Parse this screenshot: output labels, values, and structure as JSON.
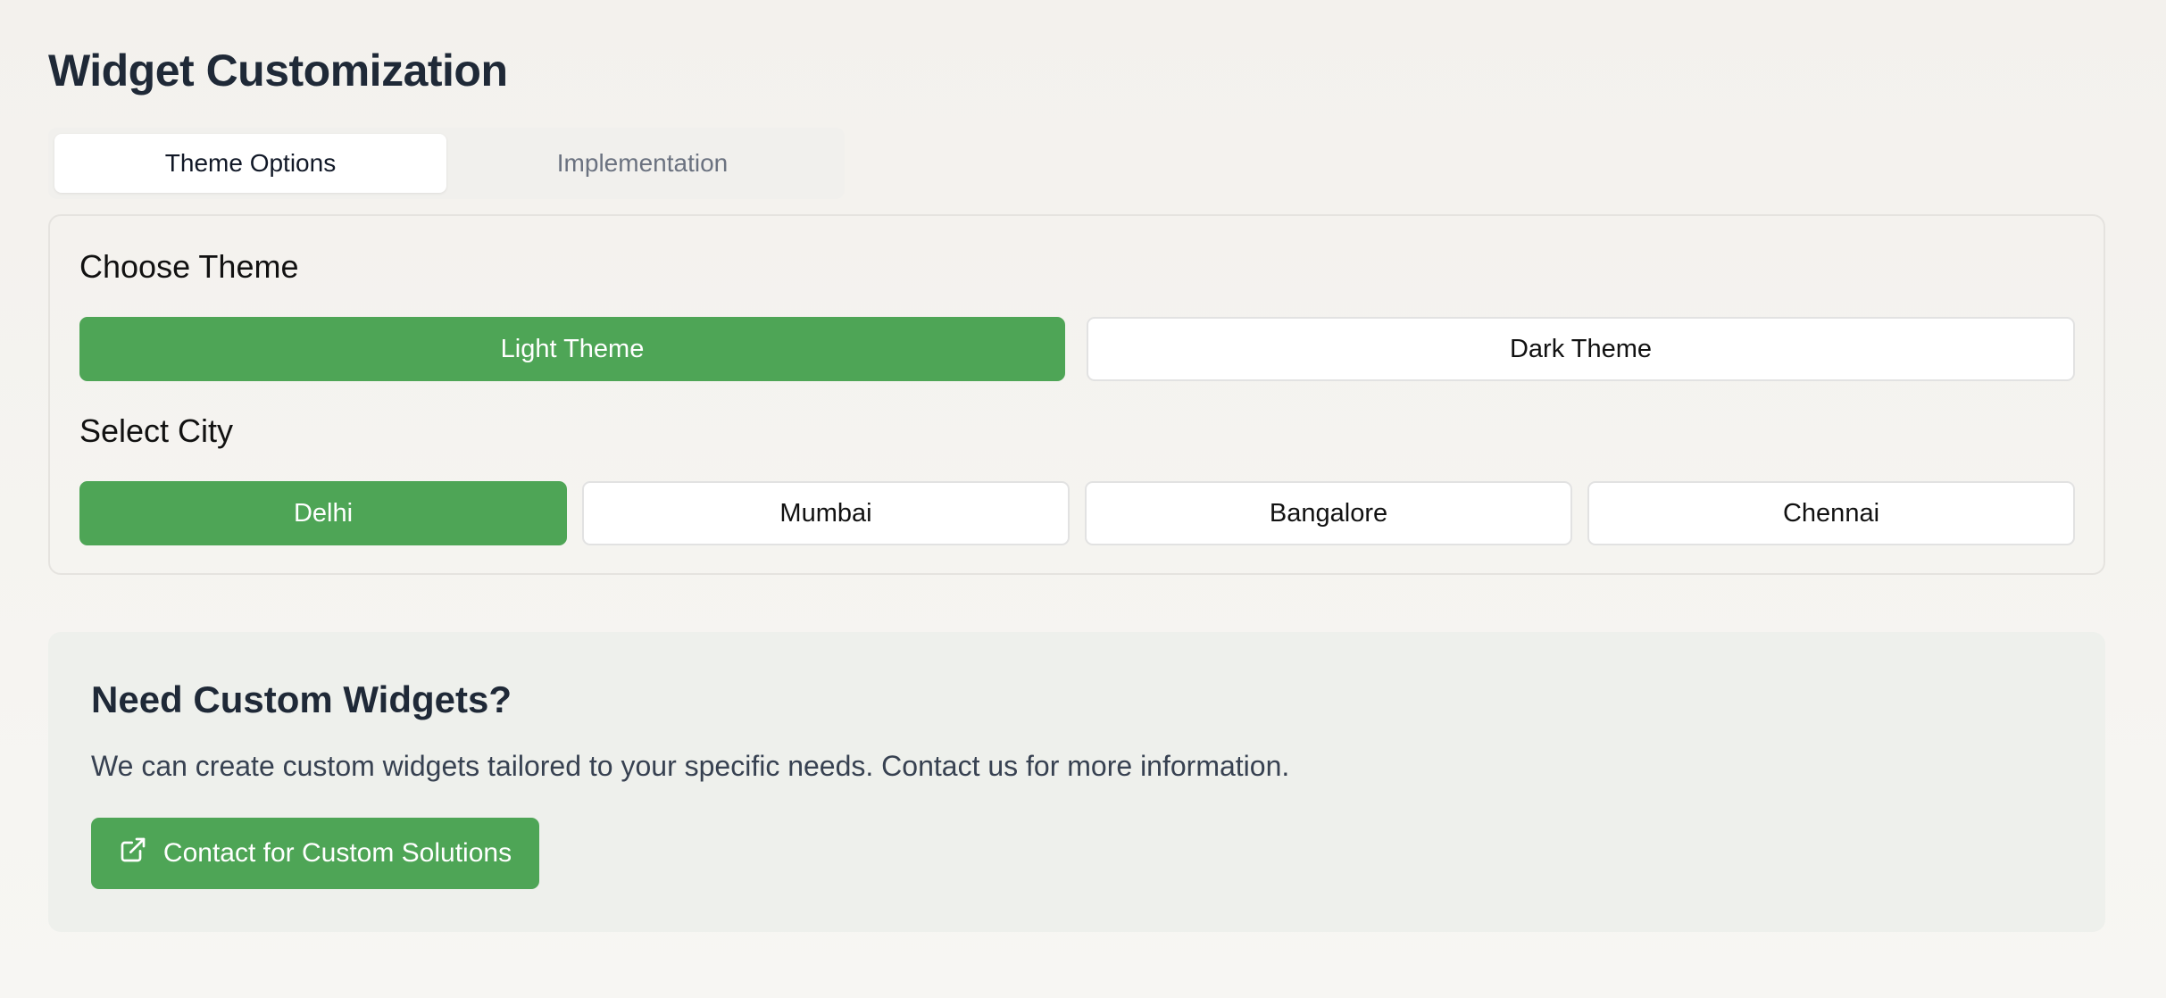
{
  "page": {
    "title": "Widget Customization"
  },
  "tabs": [
    {
      "label": "Theme Options",
      "active": true
    },
    {
      "label": "Implementation",
      "active": false
    }
  ],
  "theme_section": {
    "label": "Choose Theme",
    "options": [
      {
        "label": "Light Theme",
        "selected": true
      },
      {
        "label": "Dark Theme",
        "selected": false
      }
    ]
  },
  "city_section": {
    "label": "Select City",
    "options": [
      {
        "label": "Delhi",
        "selected": true
      },
      {
        "label": "Mumbai",
        "selected": false
      },
      {
        "label": "Bangalore",
        "selected": false
      },
      {
        "label": "Chennai",
        "selected": false
      }
    ]
  },
  "cta": {
    "title": "Need Custom Widgets?",
    "text": "We can create custom widgets tailored to your specific needs. Contact us for more information.",
    "button_label": "Contact for Custom Solutions",
    "button_icon": "external-link-icon"
  },
  "colors": {
    "accent": "#4ea556",
    "heading": "#1f2937",
    "muted": "#6b7280"
  }
}
